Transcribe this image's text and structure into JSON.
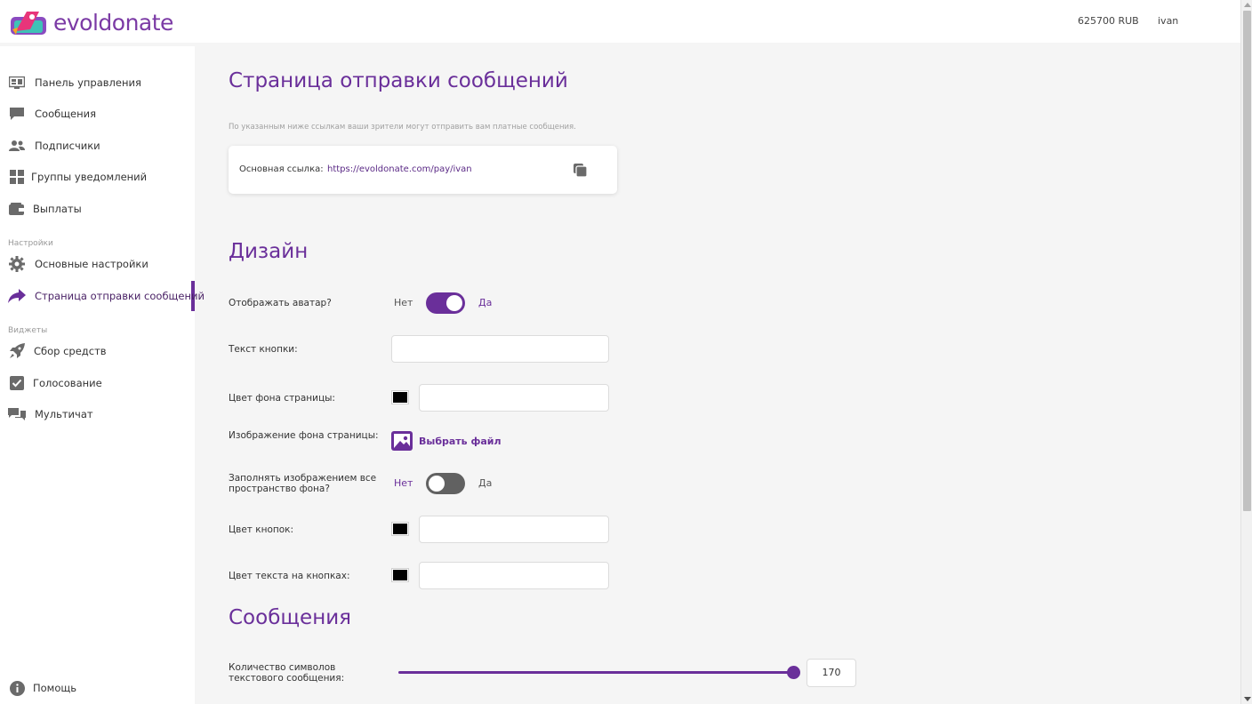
{
  "header": {
    "logo_text": "evoldonate",
    "balance": "625700 RUB",
    "username": "ivan"
  },
  "sidebar": {
    "items": [
      {
        "label": "Панель управления",
        "icon": "dashboard-icon"
      },
      {
        "label": "Сообщения",
        "icon": "chat-icon"
      },
      {
        "label": "Подписчики",
        "icon": "users-icon"
      },
      {
        "label": "Группы уведомлений",
        "icon": "grid-icon"
      },
      {
        "label": "Выплаты",
        "icon": "wallet-icon"
      }
    ],
    "settings_section": "Настройки",
    "settings_items": [
      {
        "label": "Основные настройки",
        "icon": "gear-icon"
      },
      {
        "label": "Страница отправки сообщений",
        "icon": "share-icon",
        "active": true
      }
    ],
    "widgets_section": "Виджеты",
    "widget_items": [
      {
        "label": "Сбор средств",
        "icon": "rocket-icon"
      },
      {
        "label": "Голосование",
        "icon": "checkbox-icon"
      },
      {
        "label": "Мультичат",
        "icon": "multichat-icon"
      }
    ],
    "help_label": "Помощь"
  },
  "main": {
    "title": "Страница отправки сообщений",
    "hint": "По указанным ниже ссылкам ваши зрители могут отправить вам платные сообщения.",
    "link_label": "Основная ссылка:",
    "link_url": "https://evoldonate.com/pay/ivan",
    "design_title": "Дизайн",
    "show_avatar_label": "Отображать аватар?",
    "no": "Нет",
    "yes": "Да",
    "show_avatar": true,
    "button_text_label": "Текст кнопки:",
    "button_text_value": "",
    "bg_color_label": "Цвет фона страницы:",
    "bg_color": "#000000",
    "bg_image_label": "Изображение фона страницы:",
    "choose_file": "Выбрать файл",
    "fill_bg_label": "Заполнять изображением все пространство фона?",
    "fill_bg": false,
    "button_color_label": "Цвет кнопок:",
    "button_color": "#000000",
    "button_text_color_label": "Цвет текста на кнопках:",
    "button_text_color": "#000000",
    "messages_title": "Сообщения",
    "char_count_label": "Количество символов текстового сообщения:",
    "char_count_value": "170",
    "char_count_fraction": 1.0
  },
  "colors": {
    "accent": "#6a2f9a",
    "toggle_off": "#616161"
  }
}
